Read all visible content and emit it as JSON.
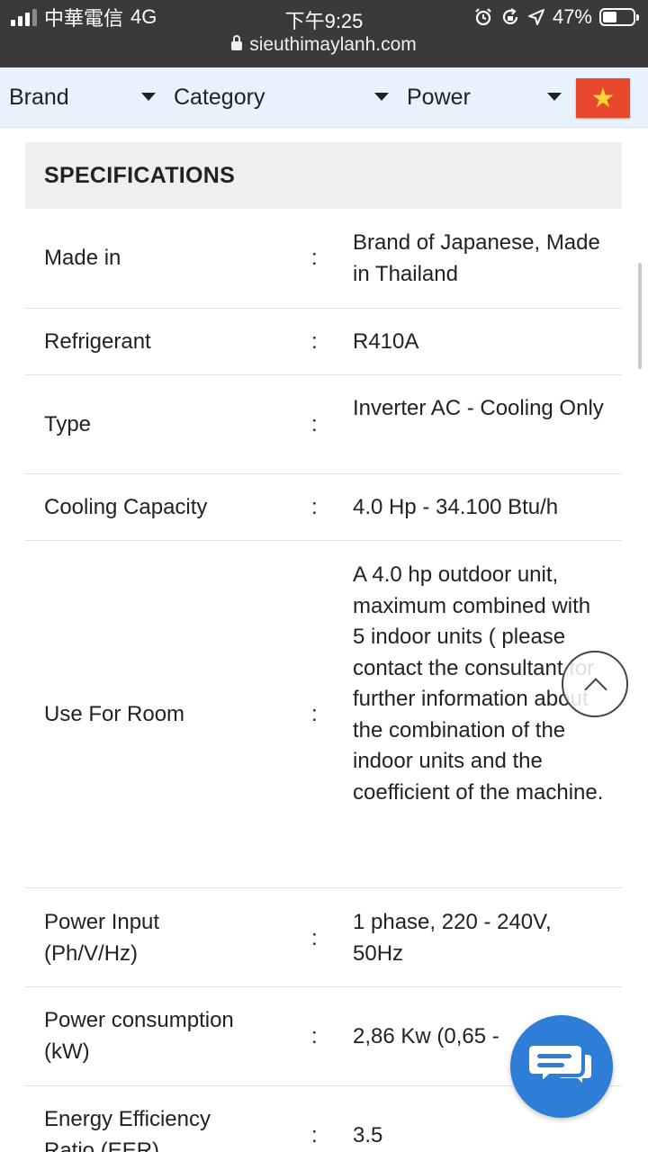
{
  "status_bar": {
    "carrier": "中華電信",
    "network": "4G",
    "time": "下午9:25",
    "battery": "47%",
    "battery_level": 0.47,
    "url": "sieuthimaylanh.com"
  },
  "filters": {
    "brand": "Brand",
    "category": "Category",
    "power": "Power",
    "flag_symbol": "★"
  },
  "specifications": {
    "title": "SPECIFICATIONS",
    "separator": ":",
    "rows": [
      {
        "label": "Made in",
        "value": "Brand of Japanese, Made in Thailand"
      },
      {
        "label": "Refrigerant",
        "value": "R410A"
      },
      {
        "label": "Type",
        "value": "Inverter AC - Cooling Only"
      },
      {
        "label": "Cooling Capacity",
        "value": "4.0 Hp - 34.100 Btu/h"
      },
      {
        "label": "Use For Room",
        "value": "A 4.0 hp outdoor unit, maximum combined with 5 indoor units ( please contact the consultant for further information about the combination of the indoor units and the coefficient of the machine."
      },
      {
        "label": "Power Input (Ph/V/Hz)",
        "value": "1 phase, 220 - 240V, 50Hz"
      },
      {
        "label": "Power consumption (kW)",
        "value": "2,86 Kw (0,65 -"
      },
      {
        "label": "Energy Efficiency Ratio (EER)",
        "value": "3.5"
      }
    ]
  },
  "colors": {
    "status_bar": "#3a3a3a",
    "filter_bar": "#e8f2fc",
    "flag": "#e8492c",
    "chat_button": "#2e7dd6"
  },
  "icons": [
    "signal-icon",
    "alarm-icon",
    "orientation-lock-icon",
    "location-icon",
    "battery-icon",
    "lock-icon",
    "dropdown-caret-icon",
    "vietnam-flag-icon",
    "chevron-up-icon",
    "chat-icon"
  ]
}
